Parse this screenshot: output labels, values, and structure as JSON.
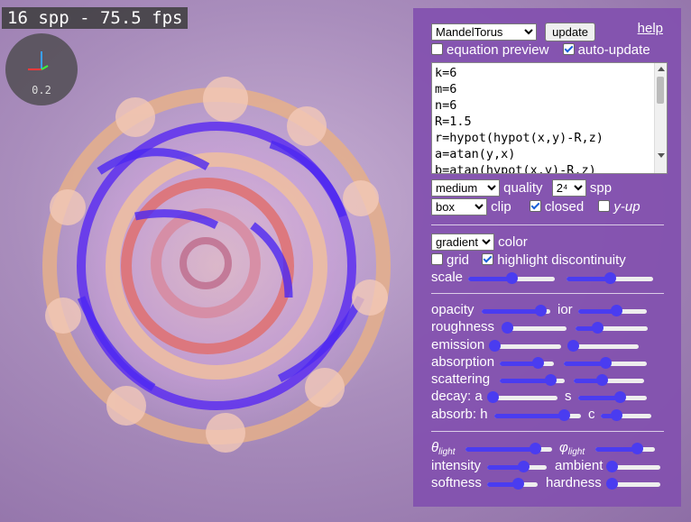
{
  "hud": {
    "fps_text": "16 spp - 75.5 fps",
    "gizmo_scale": "0.2"
  },
  "panel": {
    "help_label": "help",
    "function_select": "MandelTorus",
    "update_label": "update",
    "equation_preview": {
      "label": "equation preview",
      "checked": false
    },
    "auto_update": {
      "label": "auto-update",
      "checked": true
    },
    "code_lines": [
      "k=6",
      "m=6",
      "n=6",
      "R=1.5",
      "r=hypot(hypot(x,y)-R,z)",
      "a=atan(y,x)",
      "b=atan(hypot(x,y)-R,z)"
    ],
    "quality": {
      "value": "medium",
      "label": "quality"
    },
    "spp": {
      "value": "2⁴",
      "label": "spp"
    },
    "clip": {
      "value": "box",
      "label": "clip"
    },
    "closed": {
      "label": "closed",
      "checked": true
    },
    "y_up": {
      "label": "y-up",
      "checked": false
    },
    "color": {
      "value": "gradient",
      "label": "color"
    },
    "grid": {
      "label": "grid",
      "checked": false
    },
    "highlight": {
      "label": "highlight discontinuity",
      "checked": true
    },
    "scale_label": "scale",
    "opacity_label": "opacity",
    "ior_label": "ior",
    "roughness_label": "roughness",
    "emission_label": "emission",
    "absorption_label": "absorption",
    "scattering_label": "scattering",
    "decay_label": "decay: a",
    "s_label": "s",
    "absorb_label": "absorb: h",
    "c_label": "c",
    "theta_label": "θ",
    "theta_sub": "light",
    "phi_label": "φ",
    "phi_sub": "light",
    "intensity_label": "intensity",
    "ambient_label": "ambient",
    "softness_label": "softness",
    "hardness_label": "hardness",
    "sliders": {
      "scale_a": 0.5,
      "scale_b": 0.5,
      "opacity": 0.86,
      "ior": 0.55,
      "roughness": 0.08,
      "roughness_b": 0.3,
      "emission": 0.02,
      "emission_b": 0.02,
      "absorption": 0.7,
      "absorption_b": 0.5,
      "scattering": 0.78,
      "scattering_b": 0.4,
      "decay_a": 0.05,
      "decay_s": 0.6,
      "absorb_h": 0.8,
      "absorb_c": 0.3,
      "theta": 0.8,
      "phi": 0.7,
      "intensity": 0.6,
      "ambient": 0.04,
      "softness": 0.6,
      "hardness": 0.03
    }
  }
}
